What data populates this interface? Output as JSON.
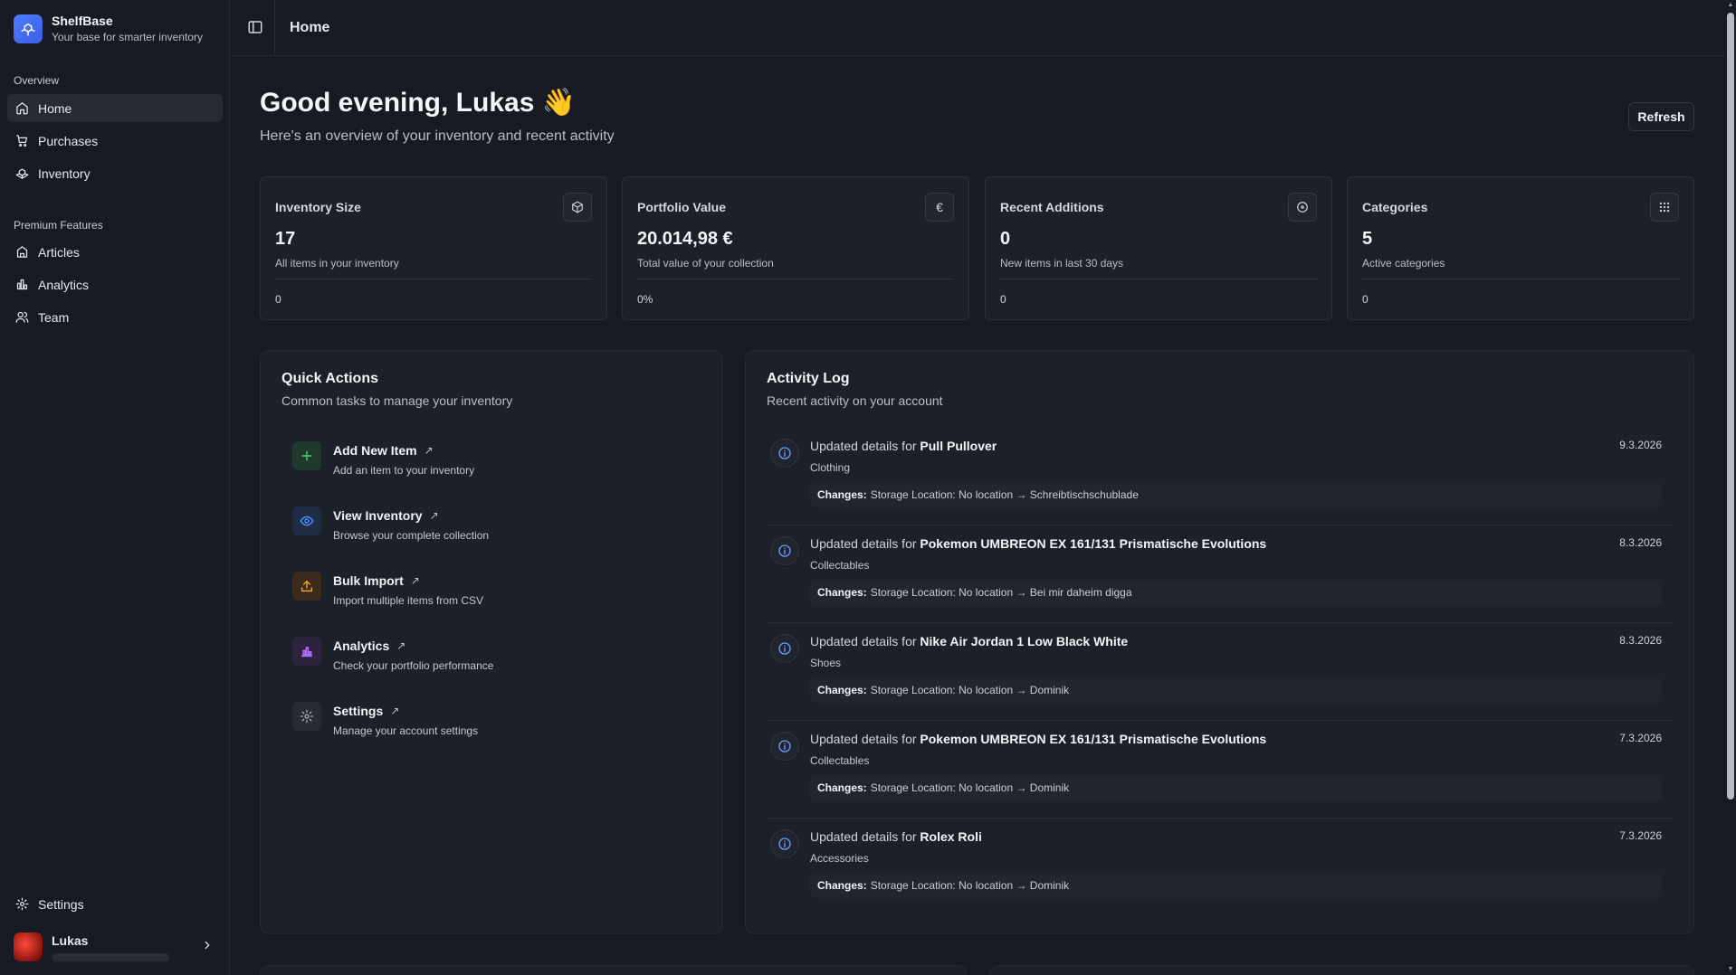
{
  "brand": {
    "name": "ShelfBase",
    "tagline": "Your base for smarter inventory"
  },
  "sidebar": {
    "overview_label": "Overview",
    "overview_items": [
      {
        "label": "Home",
        "icon": "home-icon",
        "active": true
      },
      {
        "label": "Purchases",
        "icon": "cart-icon"
      },
      {
        "label": "Inventory",
        "icon": "boxes-icon"
      }
    ],
    "premium_label": "Premium Features",
    "premium_items": [
      {
        "label": "Articles",
        "icon": "shirt-icon"
      },
      {
        "label": "Analytics",
        "icon": "bar-chart-icon"
      },
      {
        "label": "Team",
        "icon": "users-icon"
      }
    ],
    "settings_label": "Settings",
    "user_name": "Lukas"
  },
  "topbar": {
    "title": "Home"
  },
  "header": {
    "greeting": "Good evening, Lukas 👋",
    "subtitle": "Here's an overview of your inventory and recent activity",
    "refresh_label": "Refresh"
  },
  "stats": [
    {
      "title": "Inventory Size",
      "value": "17",
      "desc": "All items in your inventory",
      "foot": "0",
      "icon": "package-icon"
    },
    {
      "title": "Portfolio Value",
      "value": "20.014,98 €",
      "desc": "Total value of your collection",
      "foot": "0%",
      "icon": "euro-icon"
    },
    {
      "title": "Recent Additions",
      "value": "0",
      "desc": "New items in last 30 days",
      "foot": "0",
      "icon": "plus-circle-icon"
    },
    {
      "title": "Categories",
      "value": "5",
      "desc": "Active categories",
      "foot": "0",
      "icon": "grid-icon"
    }
  ],
  "quick_actions": {
    "title": "Quick Actions",
    "subtitle": "Common tasks to manage your inventory",
    "items": [
      {
        "label": "Add New Item",
        "desc": "Add an item to your inventory",
        "icon": "plus-icon",
        "color": "#3fbf6a",
        "bg": "#1f3a2b"
      },
      {
        "label": "View Inventory",
        "desc": "Browse your complete collection",
        "icon": "eye-icon",
        "color": "#4f8cff",
        "bg": "#1e2c45"
      },
      {
        "label": "Bulk Import",
        "desc": "Import multiple items from CSV",
        "icon": "upload-icon",
        "color": "#f29b38",
        "bg": "#3a2b1c"
      },
      {
        "label": "Analytics",
        "desc": "Check your portfolio performance",
        "icon": "bar-chart-icon",
        "color": "#b572ff",
        "bg": "#2d2340"
      },
      {
        "label": "Settings",
        "desc": "Manage your account settings",
        "icon": "gear-icon",
        "color": "#aab0ba",
        "bg": "#262b34"
      }
    ]
  },
  "activity": {
    "title": "Activity Log",
    "subtitle": "Recent activity on your account",
    "prefix": "Updated details for",
    "changes_label": "Changes:",
    "items": [
      {
        "name": "Pull Pullover",
        "category": "Clothing",
        "date": "9.3.2026",
        "change": "Storage Location: No location → Schreibtischschublade"
      },
      {
        "name": "Pokemon UMBREON EX 161/131 Prismatische Evolutions",
        "category": "Collectables",
        "date": "8.3.2026",
        "change": "Storage Location: No location → Bei mir daheim digga"
      },
      {
        "name": "Nike Air Jordan 1 Low Black White",
        "category": "Shoes",
        "date": "8.3.2026",
        "change": "Storage Location: No location → Dominik"
      },
      {
        "name": "Pokemon UMBREON EX 161/131 Prismatische Evolutions",
        "category": "Collectables",
        "date": "7.3.2026",
        "change": "Storage Location: No location → Dominik"
      },
      {
        "name": "Rolex Roli",
        "category": "Accessories",
        "date": "7.3.2026",
        "change": "Storage Location: No location → Dominik"
      }
    ]
  }
}
